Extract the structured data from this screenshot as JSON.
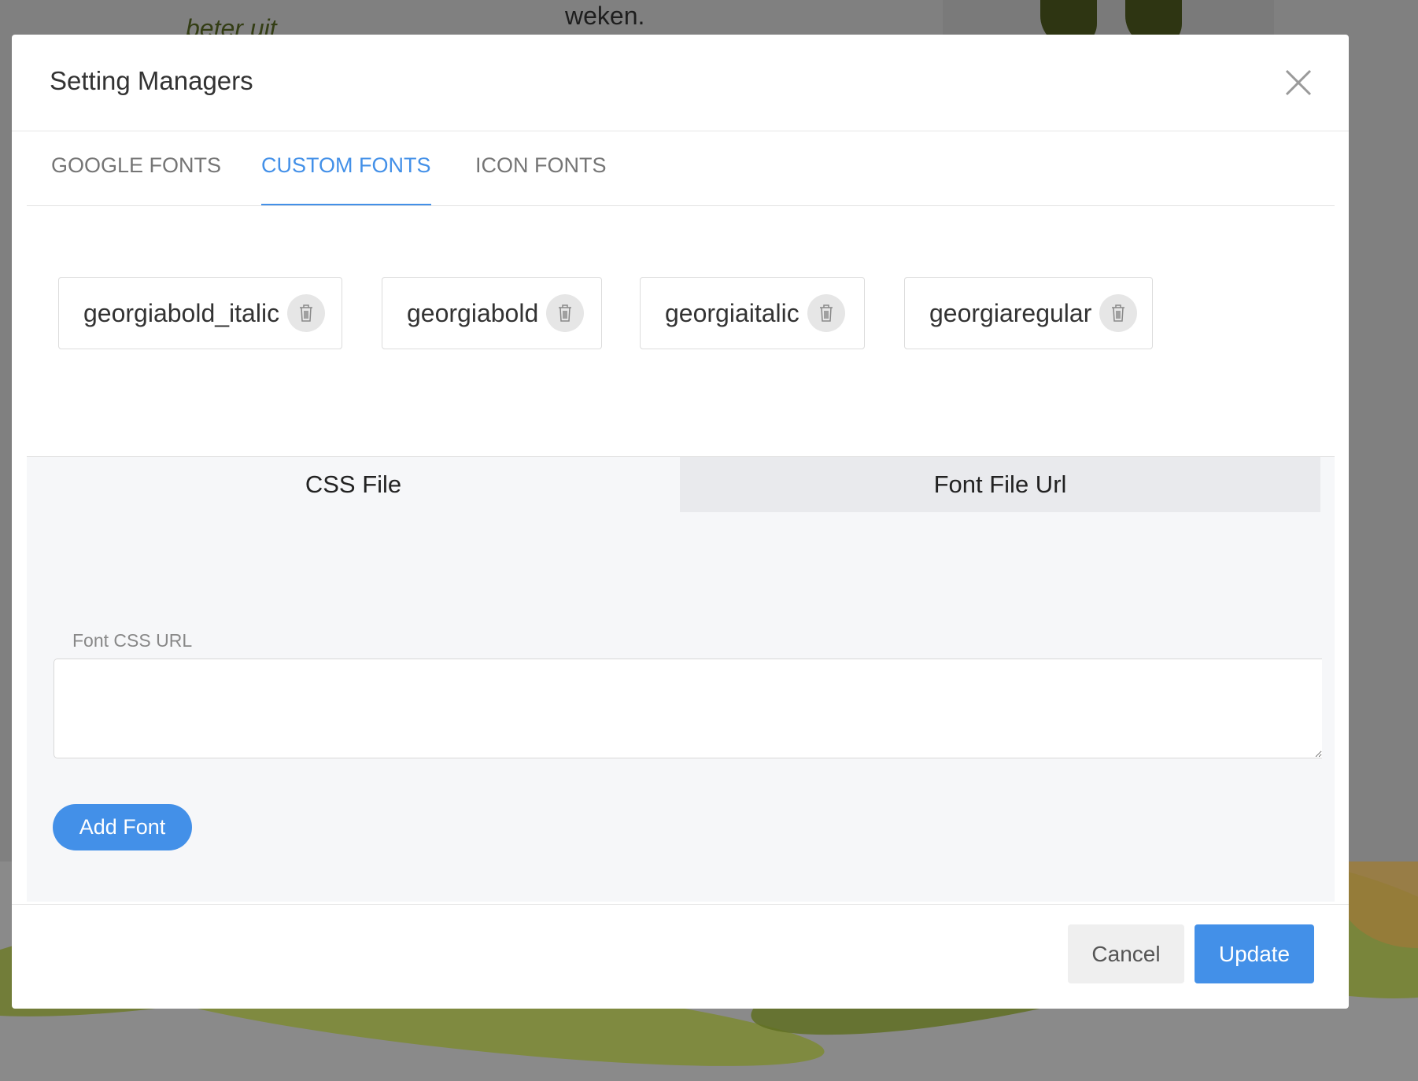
{
  "background": {
    "text_1": "weken.",
    "text_2": "beter uit"
  },
  "modal": {
    "title": "Setting Managers",
    "tabs": [
      {
        "label": "GOOGLE FONTS"
      },
      {
        "label": "CUSTOM FONTS",
        "active": true
      },
      {
        "label": "ICON FONTS"
      }
    ],
    "fonts": [
      {
        "name": "georgiabold_italic"
      },
      {
        "name": "georgiabold"
      },
      {
        "name": "georgiaitalic"
      },
      {
        "name": "georgiaregular"
      }
    ],
    "subtabs": [
      {
        "label": "CSS File",
        "active": true
      },
      {
        "label": "Font File Url"
      }
    ],
    "css_url_label": "Font CSS URL",
    "css_url_value": "",
    "add_font_label": "Add Font",
    "cancel_label": "Cancel",
    "update_label": "Update"
  },
  "colors": {
    "accent": "#4390e8"
  }
}
